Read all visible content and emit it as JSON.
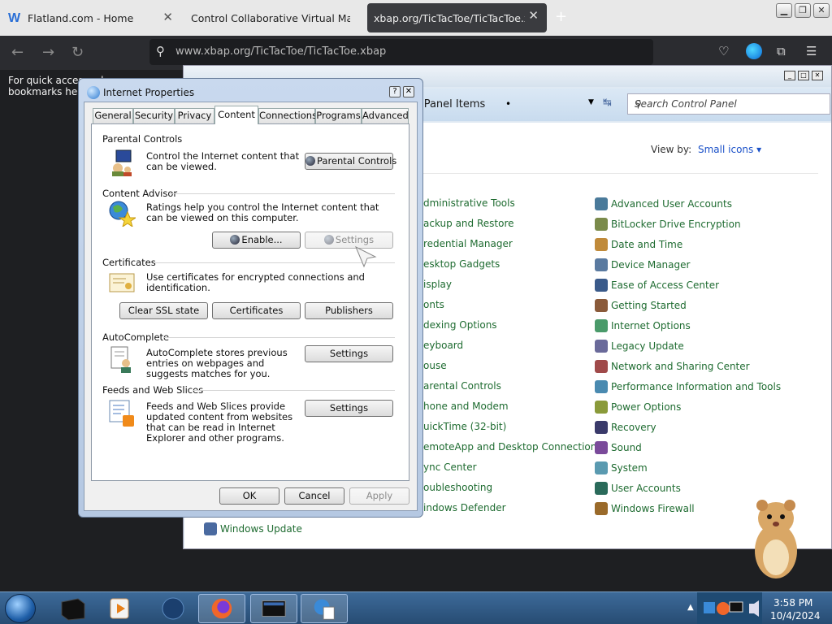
{
  "browser": {
    "tabs": [
      {
        "label": "Flatland.com - Home",
        "favicon": "W"
      },
      {
        "label": "Control Collaborative Virtual Machine"
      },
      {
        "label": "xbap.org/TicTacToe/TicTacToe.xbap"
      }
    ],
    "url": "www.xbap.org/TicTacToe/TicTacToe.xbap",
    "page_strip": "For quick access, place your bookmarks here"
  },
  "control_panel": {
    "path": "ol Panel Items",
    "search_placeholder": "Search Control Panel",
    "view_by_label": "View by:",
    "view_by_value": "Small icons ▾",
    "items_col1": [
      "dministrative Tools",
      "ackup and Restore",
      "redential Manager",
      "esktop Gadgets",
      "isplay",
      "onts",
      "dexing Options",
      "eyboard",
      "ouse",
      "arental Controls",
      "hone and Modem",
      "uickTime (32-bit)",
      "emoteApp and Desktop Connections",
      "ync Center",
      "oubleshooting",
      "indows Defender",
      "Windows Update"
    ],
    "items_col2": [
      "Advanced User Accounts",
      "BitLocker Drive Encryption",
      "Date and Time",
      "Device Manager",
      "Ease of Access Center",
      "Getting Started",
      "Internet Options",
      "Legacy Update",
      "Network and Sharing Center",
      "Performance Information and Tools",
      "Power Options",
      "Recovery",
      "Sound",
      "System",
      "User Accounts",
      "Windows Firewall"
    ]
  },
  "dialog": {
    "title": "Internet Properties",
    "tabs": [
      "General",
      "Security",
      "Privacy",
      "Content",
      "Connections",
      "Programs",
      "Advanced"
    ],
    "active_tab": "Content",
    "parental": {
      "heading": "Parental Controls",
      "desc": "Control the Internet content that can be viewed.",
      "button": "Parental Controls"
    },
    "advisor": {
      "heading": "Content Advisor",
      "desc": "Ratings help you control the Internet content that can be viewed on this computer.",
      "enable_button": "Enable...",
      "settings_button": "Settings"
    },
    "certificates": {
      "heading": "Certificates",
      "desc": "Use certificates for encrypted connections and identification.",
      "clear_ssl": "Clear SSL state",
      "certificates_button": "Certificates",
      "publishers": "Publishers"
    },
    "autocomplete": {
      "heading": "AutoComplete",
      "desc": "AutoComplete stores previous entries on webpages and suggests matches for you.",
      "settings_button": "Settings"
    },
    "feeds": {
      "heading": "Feeds and Web Slices",
      "desc": "Feeds and Web Slices provide updated content from websites that can be read in Internet Explorer and other programs.",
      "settings_button": "Settings"
    },
    "footer": {
      "ok": "OK",
      "cancel": "Cancel",
      "apply": "Apply"
    }
  },
  "taskbar": {
    "time": "3:58 PM",
    "date": "10/4/2024"
  },
  "colors": {
    "cp_link": "#1e6b30",
    "view_by_link": "#1a50c8",
    "taskbar": "#2f5a87"
  }
}
